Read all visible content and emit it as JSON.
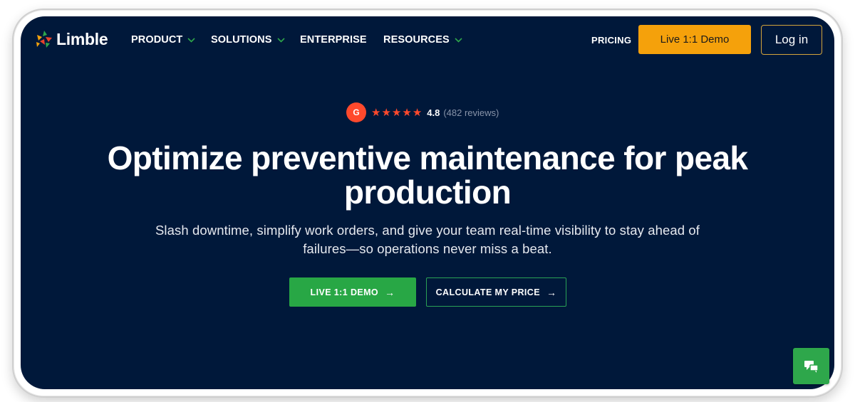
{
  "brand": {
    "name": "Limble"
  },
  "nav": {
    "items": [
      {
        "label": "PRODUCT",
        "has_dropdown": true
      },
      {
        "label": "SOLUTIONS",
        "has_dropdown": true
      },
      {
        "label": "ENTERPRISE",
        "has_dropdown": false
      },
      {
        "label": "RESOURCES",
        "has_dropdown": true
      }
    ],
    "pricing": "PRICING",
    "demo_button": "Live 1:1 Demo",
    "login_button": "Log in"
  },
  "rating": {
    "badge": "G",
    "stars": 5,
    "score": "4.8",
    "reviews": "(482 reviews)"
  },
  "hero": {
    "headline_line1": "Optimize preventive maintenance for peak",
    "headline_line2": "production",
    "subhead_line1": "Slash downtime, simplify work orders, and give your team real-time visibility to stay ahead of",
    "subhead_line2": "failures—so operations never miss a beat.",
    "primary_cta": "LIVE 1:1 DEMO",
    "secondary_cta": "CALCULATE MY PRICE"
  },
  "colors": {
    "background": "#00183a",
    "accent_orange": "#f5a10b",
    "accent_green": "#28a745",
    "star_red": "#ff492c"
  },
  "icons": {
    "logo": "limble-logo-icon",
    "dropdown": "chevron-down-icon",
    "arrow": "arrow-right-icon",
    "chat": "chat-icon"
  }
}
